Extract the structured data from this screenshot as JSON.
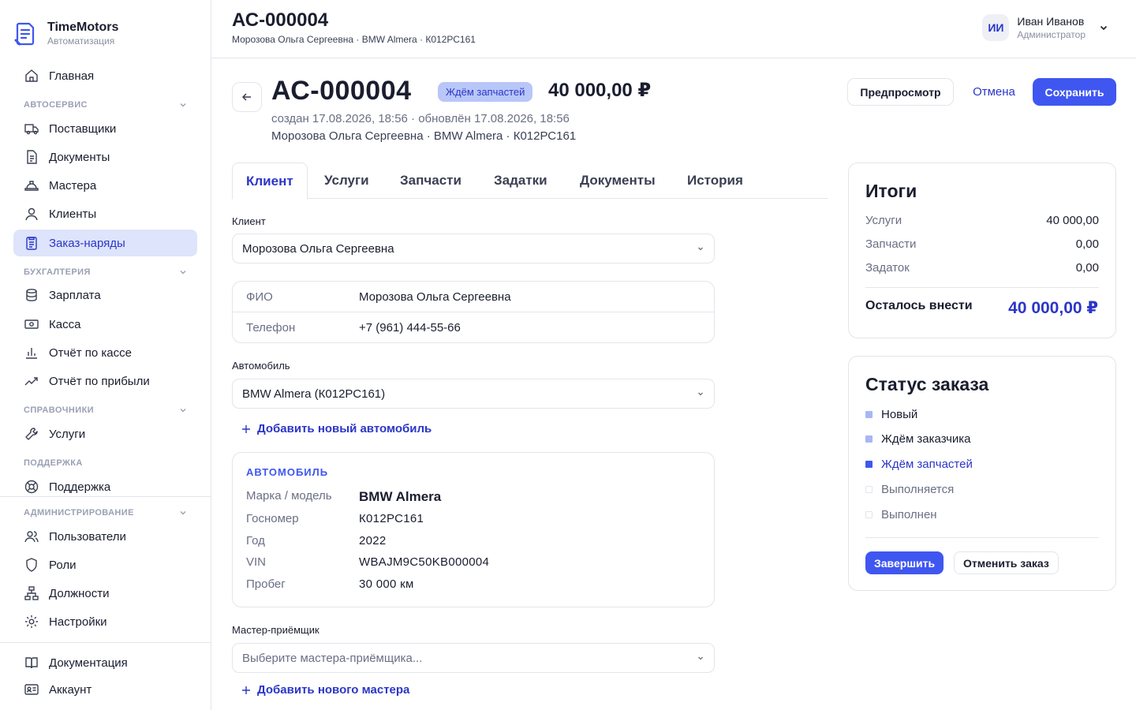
{
  "brand": {
    "name": "TimeMotors",
    "subtitle": "Автоматизация"
  },
  "sidebar": {
    "home": "Главная",
    "sections": {
      "autoservice": "АВТОСЕРВИС",
      "accounting": "БУХГАЛТЕРИЯ",
      "references": "СПРАВОЧНИКИ",
      "support": "ПОДДЕРЖКА",
      "admin": "АДМИНИСТРИРОВАНИЕ"
    },
    "items": {
      "suppliers": "Поставщики",
      "documents": "Документы",
      "masters": "Мастера",
      "clients": "Клиенты",
      "orders": "Заказ-наряды",
      "salary": "Зарплата",
      "cash": "Касса",
      "cash_report": "Отчёт по кассе",
      "profit_report": "Отчёт по прибыли",
      "services": "Услуги",
      "support": "Поддержка",
      "users": "Пользователи",
      "roles": "Роли",
      "positions": "Должности",
      "settings": "Настройки",
      "docs": "Документация",
      "account": "Аккаунт"
    }
  },
  "header": {
    "title": "АС-000004",
    "subtitle": "Морозова Ольга Сергеевна · BMW Almera · К012РС161",
    "user": {
      "initials": "ИИ",
      "name": "Иван Иванов",
      "role": "Администратор"
    }
  },
  "order": {
    "number": "АС-000004",
    "status": "Ждём запчастей",
    "total": "40 000,00 ₽",
    "dates": "создан 17.08.2026, 18:56 · обновлён 17.08.2026, 18:56",
    "summary": "Морозова Ольга Сергеевна · BMW Almera · К012РС161"
  },
  "actions": {
    "preview": "Предпросмотр",
    "cancel": "Отмена",
    "save": "Сохранить"
  },
  "tabs": [
    "Клиент",
    "Услуги",
    "Запчасти",
    "Задатки",
    "Документы",
    "История"
  ],
  "client_form": {
    "client_label": "Клиент",
    "client_value": "Морозова Ольга Сергеевна",
    "fio_label": "ФИО",
    "fio_value": "Морозова Ольга Сергеевна",
    "phone_label": "Телефон",
    "phone_value": "+7 (961) 444-55-66",
    "car_label": "Автомобиль",
    "car_value": "BMW Almera (К012РС161)",
    "add_car": "Добавить новый автомобиль",
    "car_card": {
      "heading": "АВТОМОБИЛЬ",
      "rows": [
        {
          "k": "Марка / модель",
          "v": "BMW Almera"
        },
        {
          "k": "Госномер",
          "v": "К012РС161"
        },
        {
          "k": "Год",
          "v": "2022"
        },
        {
          "k": "VIN",
          "v": "WBAJM9C50KB000004"
        },
        {
          "k": "Пробег",
          "v": "30 000 км"
        }
      ]
    },
    "master_label": "Мастер-приёмщик",
    "master_placeholder": "Выберите мастера-приёмщика...",
    "add_master": "Добавить нового мастера"
  },
  "totals": {
    "title": "Итоги",
    "rows": [
      {
        "k": "Услуги",
        "v": "40 000,00"
      },
      {
        "k": "Запчасти",
        "v": "0,00"
      },
      {
        "k": "Задаток",
        "v": "0,00"
      }
    ],
    "remaining_label": "Осталось внести",
    "remaining_value": "40 000,00 ₽"
  },
  "order_status": {
    "title": "Статус заказа",
    "steps": [
      "Новый",
      "Ждём заказчика",
      "Ждём запчастей",
      "Выполняется",
      "Выполнен"
    ],
    "complete": "Завершить",
    "cancel_order": "Отменить заказ"
  },
  "colors": {
    "accent": "#3f57f0",
    "accent_text": "#2b36c7",
    "badge": "#b8c6f8",
    "active_nav": "#dde4fb"
  }
}
